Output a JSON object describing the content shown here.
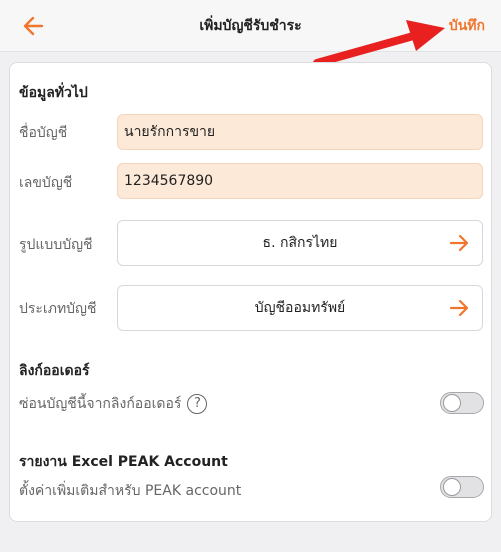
{
  "header": {
    "title": "เพิ่มบัญชีรับชำระ",
    "save_label": "บันทึก",
    "back_icon": "arrow-left-icon",
    "accent_color": "#f0762e"
  },
  "general": {
    "section_title": "ข้อมูลทั่วไป",
    "account_name_label": "ชื่อบัญชี",
    "account_name_value": "นายรักการขาย",
    "account_number_label": "เลขบัญชี",
    "account_number_value": "1234567890",
    "format_label": "รูปแบบบัญชี",
    "format_value": "ธ. กสิกรไทย",
    "type_label": "ประเภทบัญชี",
    "type_value": "บัญชีออมทรัพย์"
  },
  "order_link": {
    "section_title": "ลิงก์ออเดอร์",
    "hide_label": "ซ่อนบัญชีนี้จากลิงก์ออเดอร์",
    "help_glyph": "?",
    "hide_enabled": false
  },
  "excel_report": {
    "section_title": "รายงาน Excel PEAK Account",
    "extra_label": "ตั้งค่าเพิ่มเติมสำหรับ PEAK account",
    "extra_enabled": false
  }
}
